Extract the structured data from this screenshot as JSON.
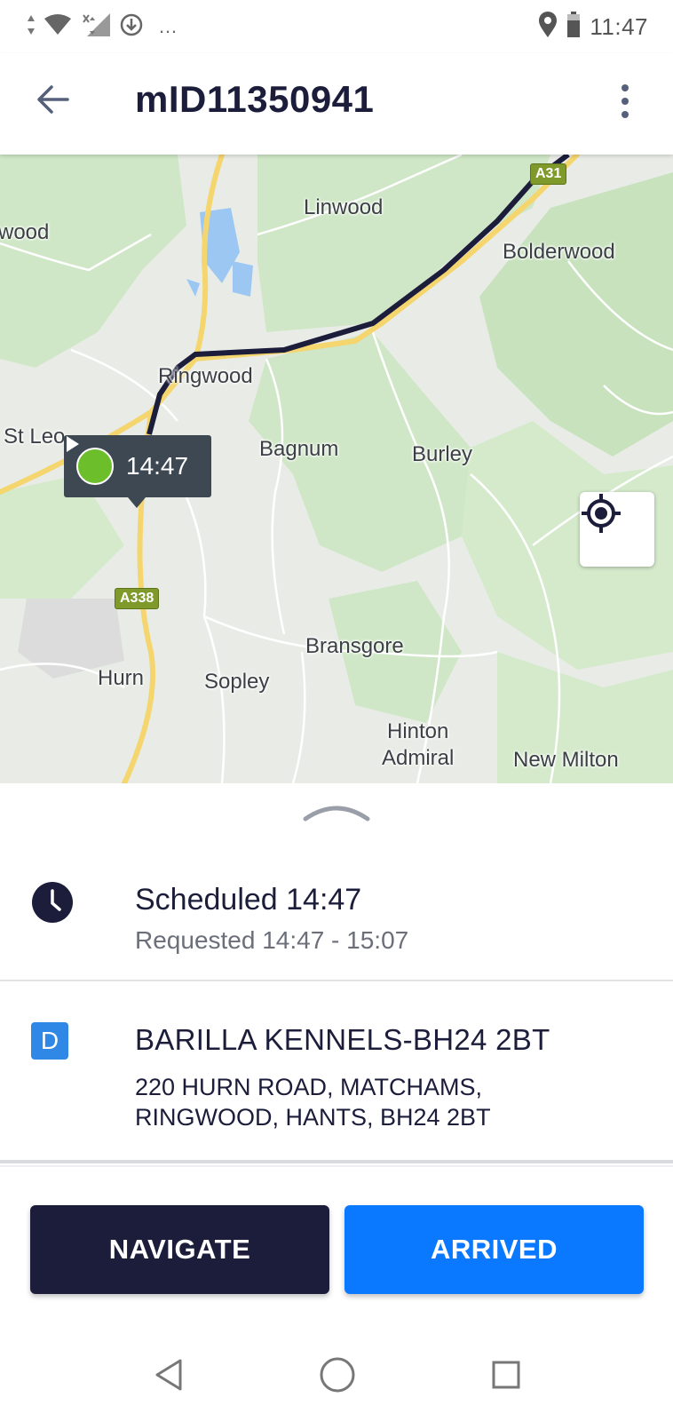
{
  "status_bar": {
    "time": "11:47",
    "overflow": "…",
    "icons": [
      "data-arrows-icon",
      "wifi-icon",
      "signal-off-icon",
      "download-icon",
      "location-pin-icon",
      "battery-icon"
    ]
  },
  "app_bar": {
    "title": "mID11350941",
    "back_icon": "arrow-back-icon",
    "menu_icon": "more-vert-icon"
  },
  "map": {
    "places": {
      "linwood": "Linwood",
      "bolderwood": "Bolderwood",
      "wood_partial": "wood",
      "ringwood": "Ringwood",
      "st_leonards_partial": "St Leo",
      "bagnum": "Bagnum",
      "burley": "Burley",
      "bransgore": "Bransgore",
      "hurn": "Hurn",
      "sopley": "Sopley",
      "hinton": "Hinton",
      "admiral": "Admiral",
      "new_milton": "New Milton"
    },
    "road_shields": {
      "a31": "A31",
      "a338": "A338"
    },
    "eta": {
      "time": "14:47",
      "icon": "play-icon"
    },
    "locate_icon": "my-location-icon",
    "colors": {
      "route": "#1b1d3b",
      "land": "#e9ece6",
      "forest": "#cfe7c6",
      "road_major": "#f5d56e",
      "water": "#9cc7f2"
    }
  },
  "sheet": {
    "handle_icon": "chevron-up-icon",
    "schedule": {
      "icon": "clock-icon",
      "title": "Scheduled 14:47",
      "requested": "Requested 14:47 - 15:07"
    },
    "destination": {
      "badge": "D",
      "name": "BARILLA KENNELS-BH24 2BT",
      "address": "220 HURN ROAD, MATCHAMS, RINGWOOD, HANTS, BH24 2BT"
    },
    "buttons": {
      "navigate": "NAVIGATE",
      "arrived": "ARRIVED"
    },
    "colors": {
      "navigate_bg": "#1b1d3b",
      "arrived_bg": "#0a78ff",
      "badge_bg": "#2f88e6"
    }
  },
  "system_nav": {
    "icons": [
      "nav-back-icon",
      "nav-home-icon",
      "nav-recents-icon"
    ]
  }
}
